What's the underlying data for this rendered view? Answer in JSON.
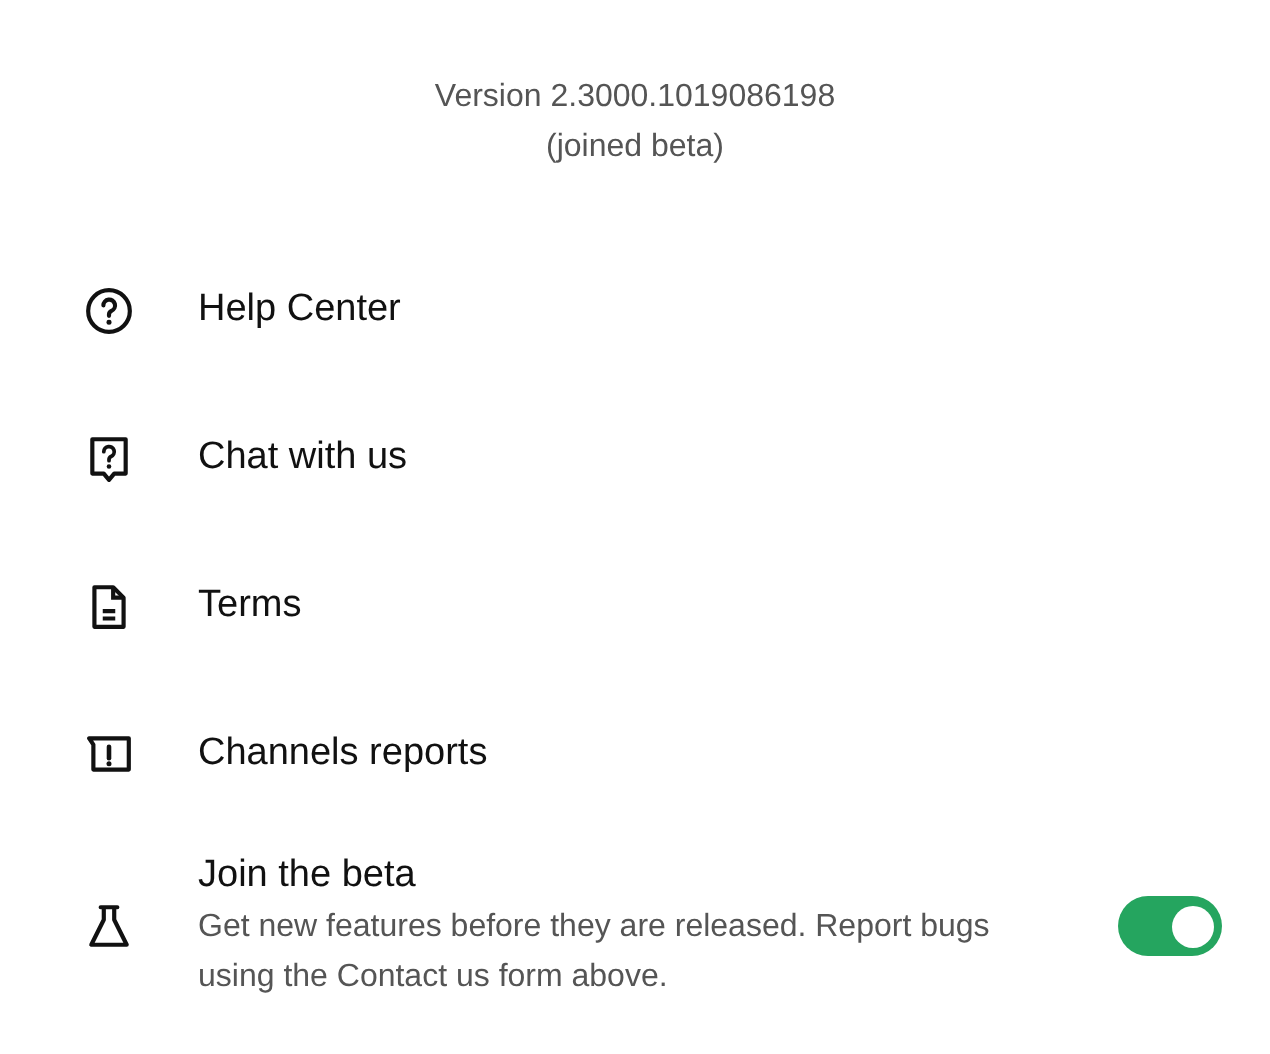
{
  "version": {
    "text": "Version 2.3000.1019086198",
    "note": "(joined beta)"
  },
  "menu": [
    {
      "kind": "help",
      "label": "Help Center"
    },
    {
      "kind": "chat",
      "label": "Chat with us"
    },
    {
      "kind": "document",
      "label": "Terms"
    },
    {
      "kind": "report",
      "label": "Channels reports"
    }
  ],
  "beta": {
    "label": "Join the beta",
    "description": "Get new features before they are released. Report bugs using the Contact us form above.",
    "on": true
  }
}
